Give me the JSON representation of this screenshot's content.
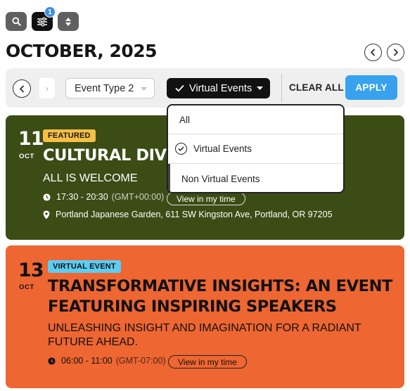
{
  "toolbar": {
    "icons": [
      "search-icon",
      "filter-sliders-icon",
      "sort-toggle-icon"
    ],
    "filter_count": "1"
  },
  "header": {
    "month_title": "OCTOBER, 2025"
  },
  "filters": {
    "stub_glyph": "›",
    "event_type": "Event Type 2",
    "virtual": "Virtual Events",
    "clear_label": "CLEAR ALL",
    "apply_label": "APPLY"
  },
  "dropdown": {
    "options": [
      "All",
      "Virtual Events",
      "Non Virtual Events"
    ],
    "selected": "Virtual Events"
  },
  "events": [
    {
      "day": "11",
      "month": "OCT",
      "badge": "FEATURED",
      "title": "CULTURAL DIVI",
      "subtitle": "ALL IS WELCOME",
      "time": "17:30 - 20:30",
      "timezone": "(GMT+00:00)",
      "view_label": "View in my time",
      "location": "Portland Japanese Garden, 611 SW Kingston Ave, Portland, OR 97205"
    },
    {
      "day": "13",
      "month": "OCT",
      "badge": "VIRTUAL EVENT",
      "title_line1": "TRANSFORMATIVE INSIGHTS: AN EVENT",
      "title_line2": "FEATURING INSPIRING SPEAKERS",
      "subtitle_line1": "UNLEASHING INSIGHT AND IMAGINATION FOR A RADIANT",
      "subtitle_line2": "FUTURE AHEAD.",
      "time": "06:00 - 11:00",
      "timezone": "(GMT-07:00)",
      "view_label": "View in my time"
    }
  ],
  "colors": {
    "featured_card": "#3b4c15",
    "virtual_card": "#ee6632",
    "featured_badge": "#f5bf45",
    "virtual_badge": "#5ccdf2",
    "apply": "#39a2ef",
    "filter_badge": "#3b8fe3"
  }
}
